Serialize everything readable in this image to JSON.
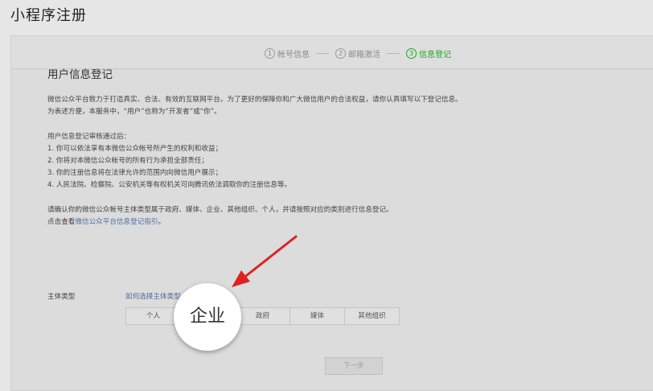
{
  "page_title": "小程序注册",
  "steps": [
    {
      "num": "1",
      "label": "帐号信息",
      "active": false
    },
    {
      "num": "2",
      "label": "邮箱激活",
      "active": false
    },
    {
      "num": "3",
      "label": "信息登记",
      "active": true
    }
  ],
  "section": {
    "title": "用户信息登记",
    "intro_line1": "微信公众平台致力于打造真实、合法、有效的互联网平台。为了更好的保障你和广大微信用户的合法权益，请你认真填写以下登记信息。",
    "intro_line2": "为表述方便，本服务中，“用户”也称为“开发者”或“你”。",
    "benefits_title": "用户信息登记审核通过后：",
    "benefits": [
      "1. 你可以依法享有本微信公众帐号所产生的权利和收益；",
      "2. 你将对本微信公众帐号的所有行为承担全部责任；",
      "3. 你的注册信息将在法律允许的范围内向微信用户展示；",
      "4. 人民法院、检察院、公安机关等有权机关可向腾讯依法调取你的注册信息等。"
    ],
    "confirm_line": "请确认你的微信公众帐号主体类型属于政府、媒体、企业、其他组织、个人，并请按照对应的类别进行信息登记。",
    "guide_prefix": "点击查看",
    "guide_link": "微信公众平台信息登记指引",
    "guide_suffix": "。"
  },
  "type_label": "主体类型",
  "type_help_link": "如何选择主体类型",
  "types": [
    "个人",
    "企业",
    "政府",
    "媒体",
    "其他组织"
  ],
  "magnifier_label": "企业",
  "next_button": "下一步",
  "colors": {
    "accent": "#1aad19",
    "link": "#4a6e9e",
    "arrow": "#e02020"
  }
}
